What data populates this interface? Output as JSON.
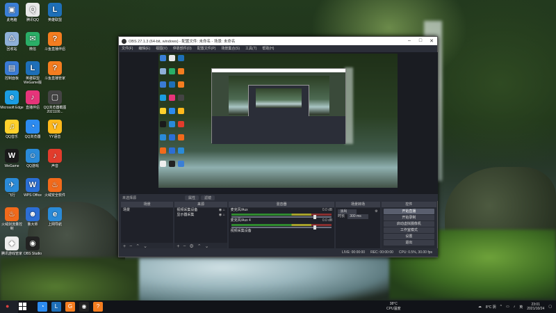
{
  "desktop": {
    "icons": [
      {
        "label": "此电脑",
        "color": "#3b7fd6",
        "glyph": "▣"
      },
      {
        "label": "腾讯QQ",
        "color": "#e8e8e8",
        "glyph": "Q"
      },
      {
        "label": "英雄联盟",
        "color": "#1e6fb8",
        "glyph": "L"
      },
      {
        "label": "回收站",
        "color": "#8fb0d8",
        "glyph": "♺"
      },
      {
        "label": "微信",
        "color": "#2aae67",
        "glyph": "✉"
      },
      {
        "label": "斗鱼直播伴侣",
        "color": "#f47d20",
        "glyph": "?"
      },
      {
        "label": "控制面板",
        "color": "#3a7bd5",
        "glyph": "▤"
      },
      {
        "label": "英雄联盟WeGame版",
        "color": "#1e6fb8",
        "glyph": "L"
      },
      {
        "label": "斗鱼直播管家",
        "color": "#f47d20",
        "glyph": "?"
      },
      {
        "label": "Microsoft Edge",
        "color": "#1b9de2",
        "glyph": "e"
      },
      {
        "label": "直播伴侣",
        "color": "#e6347a",
        "glyph": "♪"
      },
      {
        "label": "QQ浏览器截图2021100...",
        "color": "#444",
        "glyph": "▢"
      },
      {
        "label": "QQ音乐",
        "color": "#ffd12c",
        "glyph": "♫"
      },
      {
        "label": "QQ浏览器",
        "color": "#2c8bf0",
        "glyph": "◔"
      },
      {
        "label": "YY语音",
        "color": "#ffb91c",
        "glyph": "Y"
      },
      {
        "label": "WeGame",
        "color": "#1a1a1a",
        "glyph": "W"
      },
      {
        "label": "QQ游戏",
        "color": "#2a8ad8",
        "glyph": "☺"
      },
      {
        "label": "声音",
        "color": "#e23c2c",
        "glyph": "♪"
      },
      {
        "label": "飞行",
        "color": "#2a8ad8",
        "glyph": "✈"
      },
      {
        "label": "WPS Office",
        "color": "#2a6fd6",
        "glyph": "W"
      },
      {
        "label": "火绒安全软件",
        "color": "#f26a1b",
        "glyph": "♨"
      },
      {
        "label": "火绒剑流量控制",
        "color": "#f26a1b",
        "glyph": "♨"
      },
      {
        "label": "鲁大师",
        "color": "#2c6ed5",
        "glyph": "☻"
      },
      {
        "label": "上网导航",
        "color": "#2a8ad8",
        "glyph": "e"
      },
      {
        "label": "腾讯游戏管家",
        "color": "#eee",
        "glyph": "◆"
      },
      {
        "label": "OBS Studio",
        "color": "#222",
        "glyph": "◉"
      }
    ]
  },
  "obs": {
    "title": "OBS 27.1.3 (64-bit, windows) - 配置文件: 未命名 - 场景: 未命名",
    "menu": [
      "文件(F)",
      "编辑(E)",
      "视图(V)",
      "停靠部件(D)",
      "配置文件(P)",
      "场景集合(S)",
      "工具(T)",
      "帮助(H)"
    ],
    "scene_bar": {
      "label": "未选择源",
      "props": "属性",
      "filters": "滤镜"
    },
    "docks": {
      "scenes": {
        "title": "场景",
        "items": [
          "场景"
        ]
      },
      "sources": {
        "title": "来源",
        "items": [
          "视频采集设备",
          "显示器采集"
        ]
      },
      "mixer": {
        "title": "混音器",
        "channels": [
          {
            "name": "麦克风/Aux",
            "db": "0.0 dB"
          },
          {
            "name": "麦克风/Aux 4",
            "db": "0.0 dB"
          }
        ],
        "extra": "视频采集设备"
      },
      "transitions": {
        "title": "场景转场",
        "type": "淡出",
        "duration_label": "时长",
        "duration": "300 ms"
      },
      "controls": {
        "title": "控件",
        "buttons": [
          "开始直播",
          "开始录制",
          "启动虚拟摄像机",
          "工作室模式",
          "设置",
          "退出"
        ]
      }
    },
    "status": [
      "LIVE: 00:00:00",
      "REC: 00:00:00",
      "CPU: 0.5%, 30.00 fps"
    ]
  },
  "taskbar": {
    "weather_temp": "38°C",
    "weather_label": "CPU温度",
    "tray_temp": "8°C 阴",
    "lang": "英",
    "time": "23:01",
    "date": "2021/10/24"
  }
}
